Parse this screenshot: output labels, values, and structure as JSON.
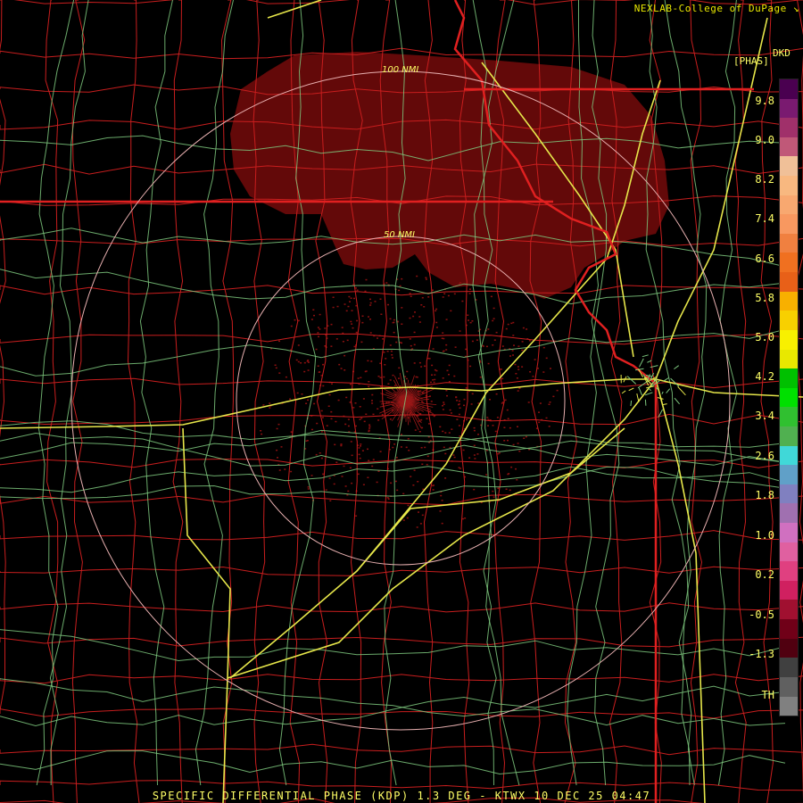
{
  "credit": "NEXLAB-College of DuPage",
  "credit_icon": "pointer-arrow-icon",
  "legend": {
    "product": "DKD",
    "unit": "[PHAS]",
    "ticks": [
      "9.8",
      "9.0",
      "8.2",
      "7.4",
      "6.6",
      "5.8",
      "5.0",
      "4.2",
      "3.4",
      "2.6",
      "1.8",
      "1.0",
      "0.2",
      "-0.5",
      "-1.3",
      "TH"
    ],
    "colors": [
      "#4a0050",
      "#7a1a70",
      "#a0306a",
      "#c05878",
      "#f0c098",
      "#f8b880",
      "#f8a870",
      "#f89860",
      "#f08040",
      "#f07020",
      "#e86018",
      "#f8b000",
      "#f8d000",
      "#f8f000",
      "#e8e800",
      "#00c000",
      "#00e000",
      "#30c030",
      "#50b050",
      "#40d8d8",
      "#60a0c8",
      "#8080c0",
      "#a070b0",
      "#d070c0",
      "#e060a0",
      "#e04080",
      "#d02060",
      "#a01030",
      "#700018",
      "#500010",
      "#404040",
      "#606060",
      "#808080"
    ]
  },
  "rings": {
    "inner_label": "50 NMI",
    "outer_label": "100 NMI"
  },
  "caption": "SPECIFIC DIFFERENTIAL PHASE (KDP) 1.3 DEG - KTWX 10 DEC 25 04:47",
  "colors": {
    "county": "#c81e1e",
    "state": "#e02020",
    "road": "#7ec87e",
    "highway": "#e6e64a",
    "ring": "#e8b0b0",
    "echo": "#6e0a0a"
  }
}
